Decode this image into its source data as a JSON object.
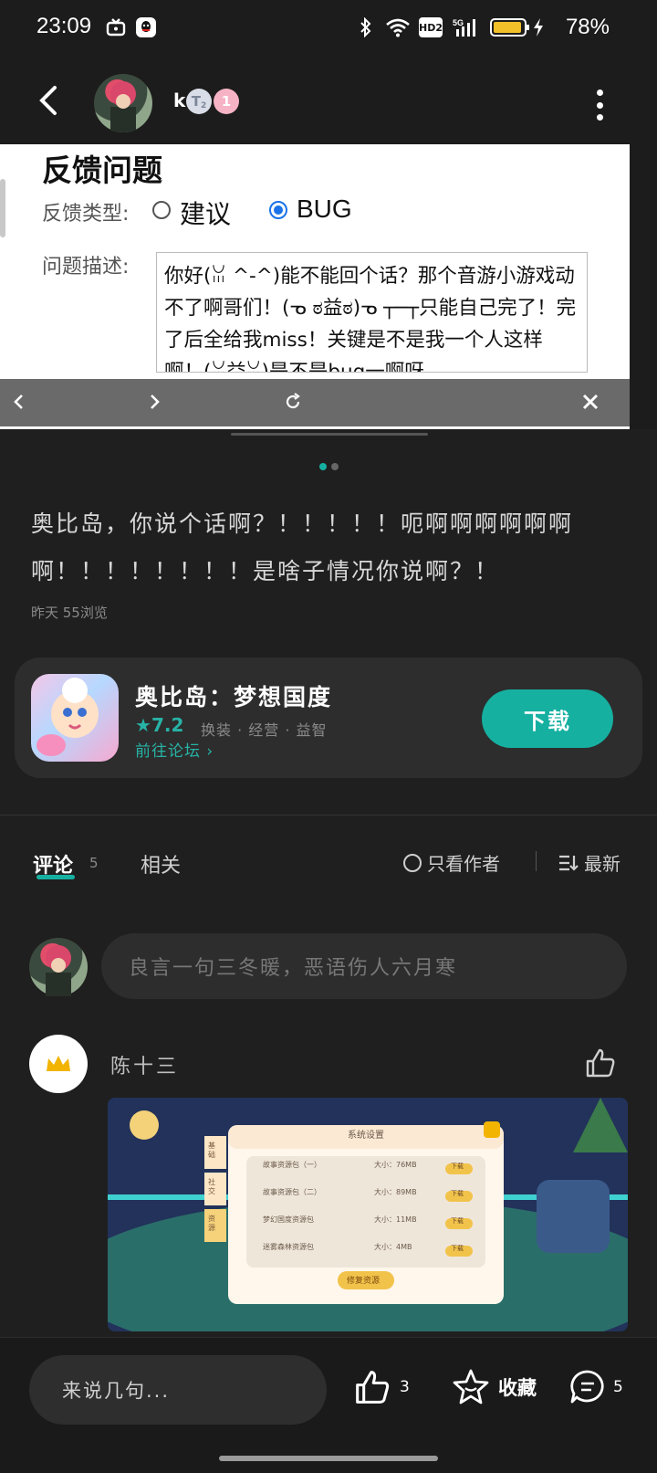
{
  "status_bar": {
    "time": "23:09",
    "network_badge": "HD2",
    "signal_label": "5G",
    "battery_percent": "78%"
  },
  "header": {
    "username": "k",
    "badge_t": "T",
    "badge_t_sub": "2",
    "badge_level": "1"
  },
  "screenshot": {
    "title": "反馈问题",
    "type_label": "反馈类型:",
    "option_suggest": "建议",
    "option_bug": "BUG",
    "selected_option": "BUG",
    "desc_label": "问题描述:",
    "desc_text": "你好(ꈍ ^-^)能不能回个话？那个音游小游戏动不了啊哥们！(ᓀ ಠ益ಠ)ᓀ ┬─┬只能自己完了！完了后全给我miss！关键是不是我一个人这样啊！(ꈍ益ꈍ)是不是bug一啊呀"
  },
  "post": {
    "text": "奥比岛，你说个话啊？！！！！！呃啊啊啊啊啊啊啊！！！！！！！！是啥子情况你说啊？！",
    "meta": "昨天 55浏览"
  },
  "game_card": {
    "name": "奥比岛：梦想国度",
    "rating": "7.2",
    "tags": "换装 · 经营 · 益智",
    "forum_link": "前往论坛",
    "download_label": "下载"
  },
  "tabs": {
    "comments_label": "评论",
    "comments_count": "5",
    "related_label": "相关",
    "only_author_label": "只看作者",
    "sort_label": "最新"
  },
  "comment_input": {
    "placeholder": "良言一句三冬暖，恶语伤人六月寒"
  },
  "comment": {
    "author": "陈十三",
    "image": {
      "dialog_title": "系统设置",
      "rows": [
        {
          "name": "故事资源包（一）",
          "size": "大小：76MB",
          "action": "下载"
        },
        {
          "name": "故事资源包（二）",
          "size": "大小：89MB",
          "action": "下载"
        },
        {
          "name": "梦幻国度资源包",
          "size": "大小：11MB",
          "action": "下载"
        },
        {
          "name": "迷雾森林资源包",
          "size": "大小：4MB",
          "action": "下载"
        }
      ],
      "repair_label": "修复资源",
      "side_tabs": [
        "基础",
        "社交",
        "资源"
      ]
    }
  },
  "bottom_bar": {
    "say_placeholder": "来说几句...",
    "like_count": "3",
    "favorite_label": "收藏",
    "comment_count": "5"
  },
  "colors": {
    "accent": "#16b0a1",
    "background": "#1f1f1f",
    "card": "#2d2d2d",
    "radio_selected": "#1a73e8"
  }
}
